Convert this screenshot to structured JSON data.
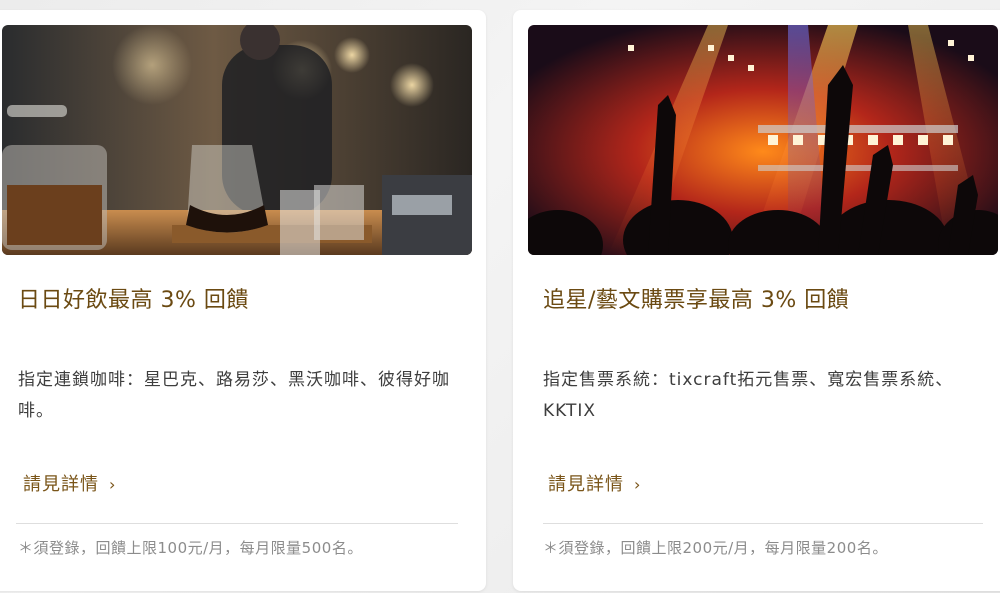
{
  "cards": [
    {
      "title": "日日好飲最高 3% 回饋",
      "description": "指定連鎖咖啡：星巴克、路易莎、黑沃咖啡、彼得好咖啡。",
      "link_label": "請見詳情",
      "link_icon": "chevron-right-icon",
      "note": "＊須登錄，回饋上限100元/月，每月限量500名。",
      "image_subject": "coffee-bar-photo"
    },
    {
      "title": "追星/藝文購票享最高 3% 回饋",
      "description": "指定售票系統：tixcraft拓元售票、寬宏售票系統、KKTIX",
      "link_label": "請見詳情",
      "link_icon": "chevron-right-icon",
      "note": "＊須登錄，回饋上限200元/月，每月限量200名。",
      "image_subject": "concert-crowd-photo"
    }
  ],
  "colors": {
    "title": "#6b4a12",
    "link": "#7a5519",
    "body_text": "#3e3e3e",
    "note_text": "#8c8c8c"
  }
}
